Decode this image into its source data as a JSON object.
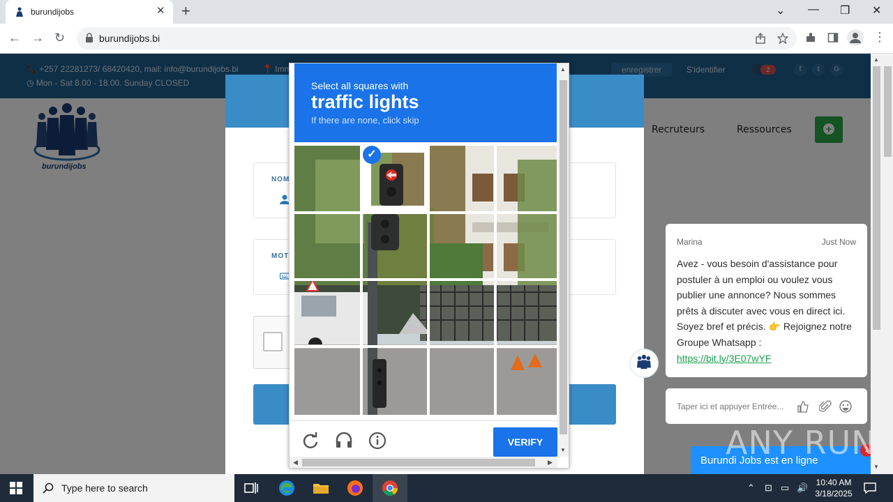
{
  "browser": {
    "tab_title": "burundijobs",
    "url": "burundijobs.bi"
  },
  "site": {
    "contact": "+257 22281273/ 68420420, mail: info@burundijobs.bi",
    "hours": "Mon - Sat 8.00 - 18.00. Sunday CLOSED",
    "address_fragment": "Imm",
    "register": "enregistrer",
    "login": "S'identifier",
    "cart_count": "2",
    "logo_text": "burundijobs",
    "nav": [
      "Recruteurs",
      "Ressources"
    ],
    "form": {
      "name_label": "NOM",
      "password_label": "MOT"
    }
  },
  "captcha": {
    "instruction": "Select all squares with",
    "target": "traffic lights",
    "hint": "If there are none, click skip",
    "verify_label": "VERIFY",
    "selected_tiles": [
      1
    ]
  },
  "chat": {
    "agent_name": "Marina",
    "time": "Just Now",
    "message": "Avez - vous besoin d'assistance pour postuler à un emploi ou voulez vous publier une annonce? Nous sommes prêts à discuter avec vous en direct ici. Soyez bref et précis. 👉 Rejoignez notre Groupe Whatsapp :",
    "link": "https://bit.ly/3E07wYF",
    "input_placeholder": "Taper ici et appuyer Entrée...",
    "status_bar": "Burundi Jobs est en ligne",
    "unread": "1"
  },
  "watermark": "ANY RUN",
  "taskbar": {
    "search_placeholder": "Type here to search",
    "time": "10:40 AM",
    "date": "3/18/2025"
  },
  "colors": {
    "site_primary": "#1f5f8f",
    "captcha_blue": "#1a73e8",
    "chat_link": "#16a34a",
    "chat_bar": "#1e90ff",
    "add_button": "#28a745"
  }
}
